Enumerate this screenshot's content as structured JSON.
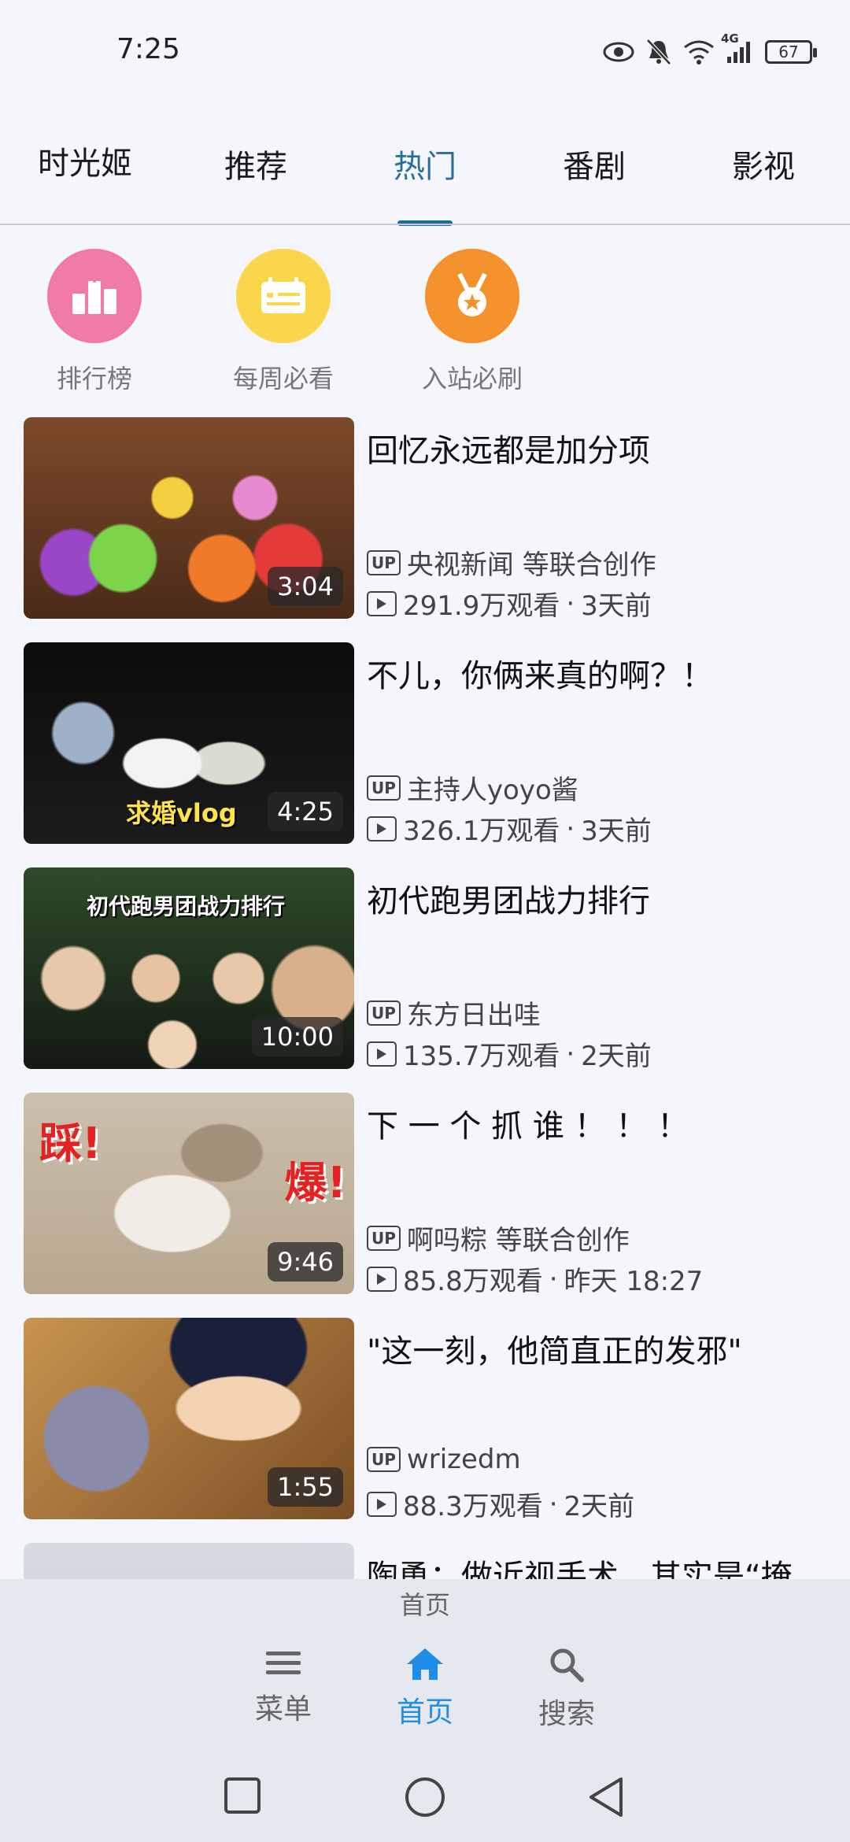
{
  "status_bar": {
    "time": "7:25",
    "battery": "67",
    "network": "4G",
    "icons": [
      "eye-icon",
      "mute-bell-icon",
      "wifi-icon",
      "signal-icon",
      "battery-icon"
    ]
  },
  "tabs": [
    {
      "label": "时光姬",
      "active": false
    },
    {
      "label": "推荐",
      "active": false
    },
    {
      "label": "热门",
      "active": true
    },
    {
      "label": "番剧",
      "active": false
    },
    {
      "label": "影视",
      "active": false
    }
  ],
  "quick_links": [
    {
      "label": "排行榜",
      "icon": "ranking-icon",
      "color": "#f17aa6"
    },
    {
      "label": "每周必看",
      "icon": "weekly-calendar-icon",
      "color": "#fad64a"
    },
    {
      "label": "入站必刷",
      "icon": "medal-icon",
      "color": "#f4922c"
    }
  ],
  "videos": [
    {
      "title": "回忆永远都是加分项",
      "duration": "3:04",
      "up": "央视新闻 等联合创作",
      "views": "291.9万观看",
      "time": "3天前"
    },
    {
      "title": "不儿，你俩来真的啊？！",
      "duration": "4:25",
      "up": "主持人yoyo酱",
      "views": "326.1万观看",
      "time": "3天前",
      "thumb_text": "求婚vlog"
    },
    {
      "title": "初代跑男团战力排行",
      "duration": "10:00",
      "up": "东方日出哇",
      "views": "135.7万观看",
      "time": "2天前",
      "thumb_text": "初代跑男团战力排行"
    },
    {
      "title": "下 一 个 抓 谁 ！ ！ ！",
      "duration": "9:46",
      "up": "啊吗粽 等联合创作",
      "views": "85.8万观看",
      "time": "昨天 18:27",
      "thumb_text_left": "踩!",
      "thumb_text_right": "爆!"
    },
    {
      "title": "\"这一刻，他简直正的发邪\"",
      "duration": "1:55",
      "up": "wrizedm",
      "views": "88.3万观看",
      "time": "2天前"
    },
    {
      "title": "陶勇：做近视手术，其实是“掩",
      "duration": "",
      "up": "",
      "views": "",
      "time": ""
    }
  ],
  "bottom_nav": {
    "hint": "首页",
    "items": [
      {
        "label": "菜单",
        "icon": "menu-icon",
        "active": false
      },
      {
        "label": "首页",
        "icon": "home-icon",
        "active": true
      },
      {
        "label": "搜索",
        "icon": "search-icon",
        "active": false
      }
    ]
  },
  "colors": {
    "accent": "#1f6e98",
    "nav_active": "#1f8ee8",
    "background": "#f4f6fb"
  }
}
